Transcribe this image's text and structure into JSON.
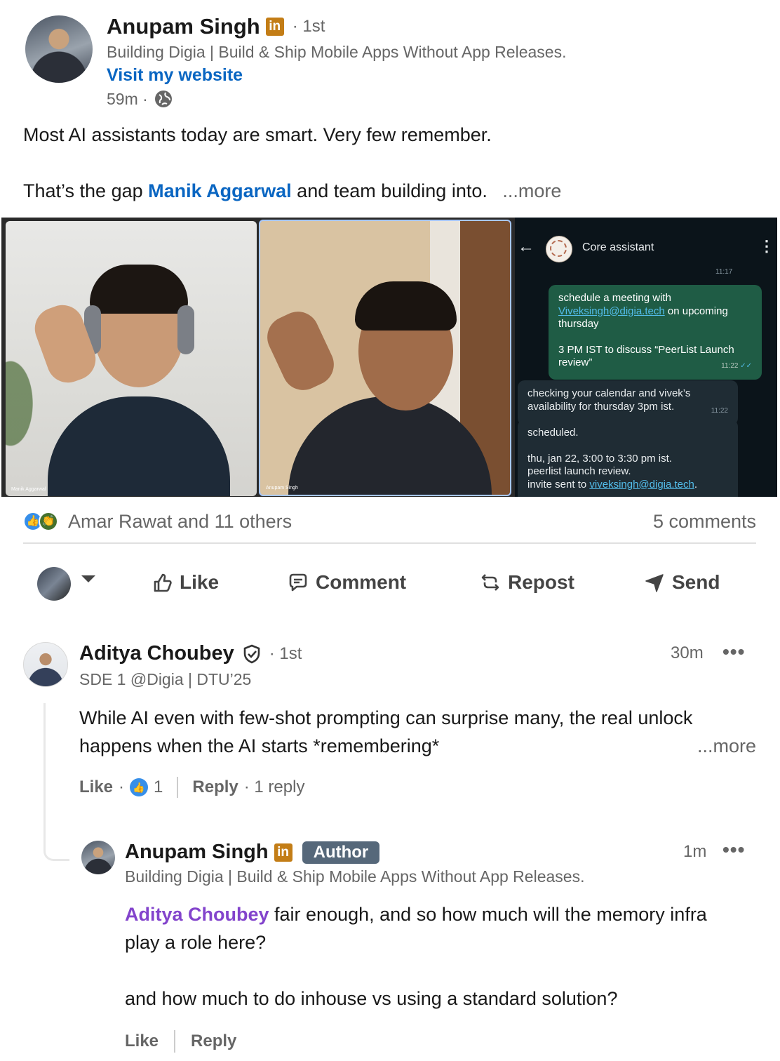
{
  "post": {
    "author": {
      "name": "Anupam Singh",
      "badge_letters": "in",
      "degree": "· 1st",
      "headline": "Building Digia | Build & Ship Mobile Apps Without App Releases.",
      "website_link": "Visit my website",
      "time": "59m ·"
    },
    "text_line1": "Most AI assistants today are smart. Very few remember.",
    "text_line2_pre": "That’s the gap ",
    "text_line2_mention": "Manik Aggarwal",
    "text_line2_post": " and team building into.",
    "more": "...more",
    "images": {
      "left_caption": "Manik Aggarwal",
      "middle_caption": "Anupam Singh",
      "chat": {
        "title": "Core assistant",
        "partial_time": "11:17",
        "out_msg_1_pre": "schedule a meeting with",
        "out_msg_1_link": "Viveksingh@digia.tech",
        "out_msg_1_post": "on upcoming thursday",
        "out_msg_2": "3 PM IST to  discuss “PeerList Launch review”",
        "out_time": "11:22",
        "in_msg_1": "checking your calendar and vivek’s availability for thursday 3pm ist.",
        "in_time_1": "11:22",
        "in_msg_2_l1": "scheduled.",
        "in_msg_2_l2": "thu, jan 22, 3:00 to 3:30 pm ist.",
        "in_msg_2_l3": "peerlist launch review.",
        "in_msg_2_l4_pre": "invite sent to ",
        "in_msg_2_l4_link": "viveksingh@digia.tech",
        "in_msg_2_l4_post": "."
      }
    },
    "reactions_text": "Amar Rawat and 11 others",
    "comments_count": "5 comments",
    "actions": {
      "like": "Like",
      "comment": "Comment",
      "repost": "Repost",
      "send": "Send"
    }
  },
  "comments": [
    {
      "name": "Aditya Choubey",
      "degree": "· 1st",
      "headline": "SDE 1 @Digia | DTU’25",
      "time": "30m",
      "text_line1": "While AI even with few-shot prompting can surprise many, the real unlock",
      "text_line2": "happens when the AI starts *remembering*",
      "more": "...more",
      "like": "Like",
      "like_sep": "·",
      "like_count": "1",
      "reply": "Reply",
      "reply_count": "· 1 reply"
    }
  ],
  "reply": {
    "name": "Anupam Singh",
    "badge_letters": "in",
    "author_label": "Author",
    "headline": "Building Digia | Build & Ship Mobile Apps Without App Releases.",
    "time": "1m",
    "mention": "Aditya Choubey",
    "text_line1_post": " fair enough, and so how much will the memory infra",
    "text_line2": "play a role here?",
    "text_line3": "and how much to do inhouse vs using a standard solution?",
    "like": "Like",
    "reply": "Reply"
  },
  "icons": [
    "globe-icon",
    "like-thumb-icon",
    "comment-icon",
    "repost-icon",
    "send-icon",
    "chevron-down-icon",
    "verified-shield-icon",
    "more-dots-icon",
    "back-arrow-icon"
  ],
  "colors": {
    "link_blue": "#0a66c2",
    "mention_purple": "#8344cc",
    "linkedin_gold": "#c37d16",
    "author_badge": "#56687a"
  }
}
